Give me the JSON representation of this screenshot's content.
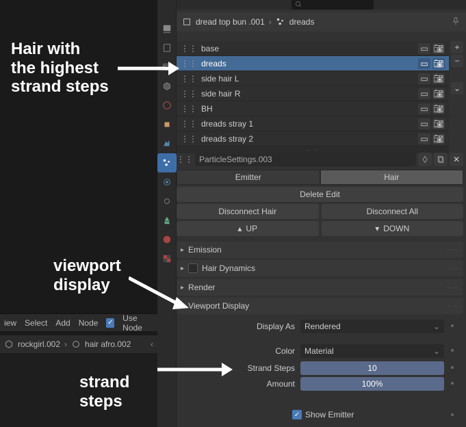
{
  "breadcrumb": {
    "object": "dread top bun .001",
    "system": "dreads"
  },
  "particle_systems": [
    {
      "name": "base",
      "selected": false
    },
    {
      "name": "dreads",
      "selected": true
    },
    {
      "name": "side hair L",
      "selected": false
    },
    {
      "name": "side hair R",
      "selected": false
    },
    {
      "name": "BH",
      "selected": false
    },
    {
      "name": "dreads stray 1",
      "selected": false
    },
    {
      "name": "dreads stray 2",
      "selected": false
    }
  ],
  "settings_name": "ParticleSettings.003",
  "tabs": {
    "emitter": "Emitter",
    "hair": "Hair"
  },
  "delete_edit": "Delete Edit",
  "disconnect_hair": "Disconnect Hair",
  "disconnect_all": "Disconnect All",
  "up": "UP",
  "down": "DOWN",
  "sections": {
    "emission": "Emission",
    "hair_dynamics": "Hair Dynamics",
    "render": "Render",
    "viewport_display": "Viewport Display"
  },
  "viewport": {
    "display_as_label": "Display As",
    "display_as_value": "Rendered",
    "color_label": "Color",
    "color_value": "Material",
    "strand_steps_label": "Strand Steps",
    "strand_steps_value": "10",
    "amount_label": "Amount",
    "amount_value": "100%",
    "show_emitter": "Show Emitter"
  },
  "annotations": {
    "strand_hair": "Hair with the highest strand steps",
    "viewport_display": "viewport display",
    "strand_steps": "strand steps"
  },
  "editor_menu": {
    "view": "iew",
    "select": "Select",
    "add": "Add",
    "node": "Node",
    "use_nodes": "Use Node"
  },
  "editor_breadcrumb": {
    "item1": "rockgirl.002",
    "item2": "hair afro.002"
  }
}
